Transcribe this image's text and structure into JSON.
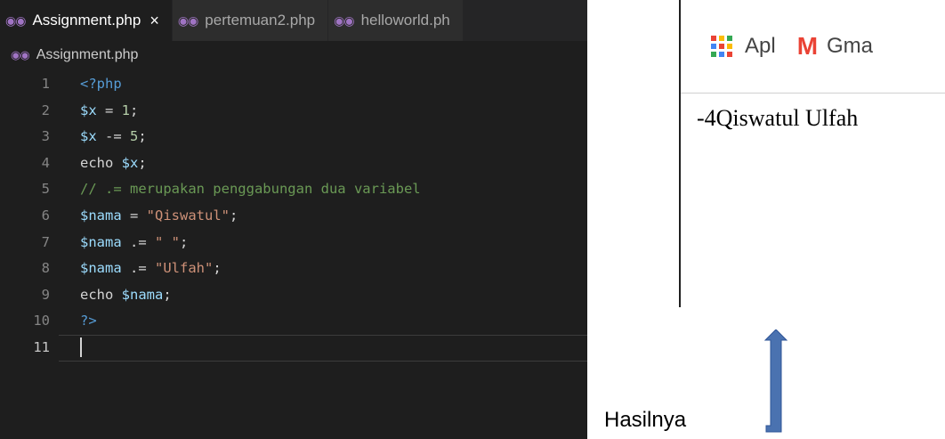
{
  "editor": {
    "tabs": [
      {
        "label": "Assignment.php",
        "active": true,
        "close": "×"
      },
      {
        "label": "pertemuan2.php",
        "active": false
      },
      {
        "label": "helloworld.ph",
        "active": false
      }
    ],
    "breadcrumb": "Assignment.php",
    "lines": [
      {
        "n": "1",
        "tokens": [
          {
            "t": "<?php",
            "c": "tag"
          }
        ]
      },
      {
        "n": "2",
        "tokens": [
          {
            "t": "$x",
            "c": "var"
          },
          {
            "t": " = ",
            "c": "op"
          },
          {
            "t": "1",
            "c": "num"
          },
          {
            "t": ";",
            "c": "op"
          }
        ]
      },
      {
        "n": "3",
        "tokens": [
          {
            "t": "$x",
            "c": "var"
          },
          {
            "t": " -= ",
            "c": "op"
          },
          {
            "t": "5",
            "c": "num"
          },
          {
            "t": ";",
            "c": "op"
          }
        ]
      },
      {
        "n": "4",
        "tokens": [
          {
            "t": "echo ",
            "c": "op"
          },
          {
            "t": "$x",
            "c": "var"
          },
          {
            "t": ";",
            "c": "op"
          }
        ]
      },
      {
        "n": "5",
        "tokens": [
          {
            "t": "// .= merupakan penggabungan dua variabel",
            "c": "com"
          }
        ]
      },
      {
        "n": "6",
        "tokens": [
          {
            "t": "$nama",
            "c": "var"
          },
          {
            "t": " = ",
            "c": "op"
          },
          {
            "t": "\"Qiswatul\"",
            "c": "str"
          },
          {
            "t": ";",
            "c": "op"
          }
        ]
      },
      {
        "n": "7",
        "tokens": [
          {
            "t": "$nama",
            "c": "var"
          },
          {
            "t": " .= ",
            "c": "op"
          },
          {
            "t": "\" \"",
            "c": "str"
          },
          {
            "t": ";",
            "c": "op"
          }
        ]
      },
      {
        "n": "8",
        "tokens": [
          {
            "t": "$nama",
            "c": "var"
          },
          {
            "t": " .= ",
            "c": "op"
          },
          {
            "t": "\"Ulfah\"",
            "c": "str"
          },
          {
            "t": ";",
            "c": "op"
          }
        ]
      },
      {
        "n": "9",
        "tokens": [
          {
            "t": "echo ",
            "c": "op"
          },
          {
            "t": "$nama",
            "c": "var"
          },
          {
            "t": ";",
            "c": "op"
          }
        ]
      },
      {
        "n": "10",
        "tokens": [
          {
            "t": "?>",
            "c": "tag"
          }
        ]
      },
      {
        "n": "11",
        "tokens": [],
        "cursor": true
      }
    ]
  },
  "browser": {
    "bookmarks": {
      "apps_label": "Apl",
      "gmail_label": "Gma"
    },
    "output": "-4Qiswatul Ulfah"
  },
  "annotation": {
    "label": "Hasilnya",
    "arrow_color": "#4a72b0"
  },
  "colors": {
    "editor_bg": "#1e1e1e",
    "php_icon": "#a074c4",
    "variable": "#9cdcfe",
    "string": "#ce9178",
    "number": "#b5cea8",
    "comment": "#6a9955",
    "keyword_tag": "#569cd6"
  }
}
